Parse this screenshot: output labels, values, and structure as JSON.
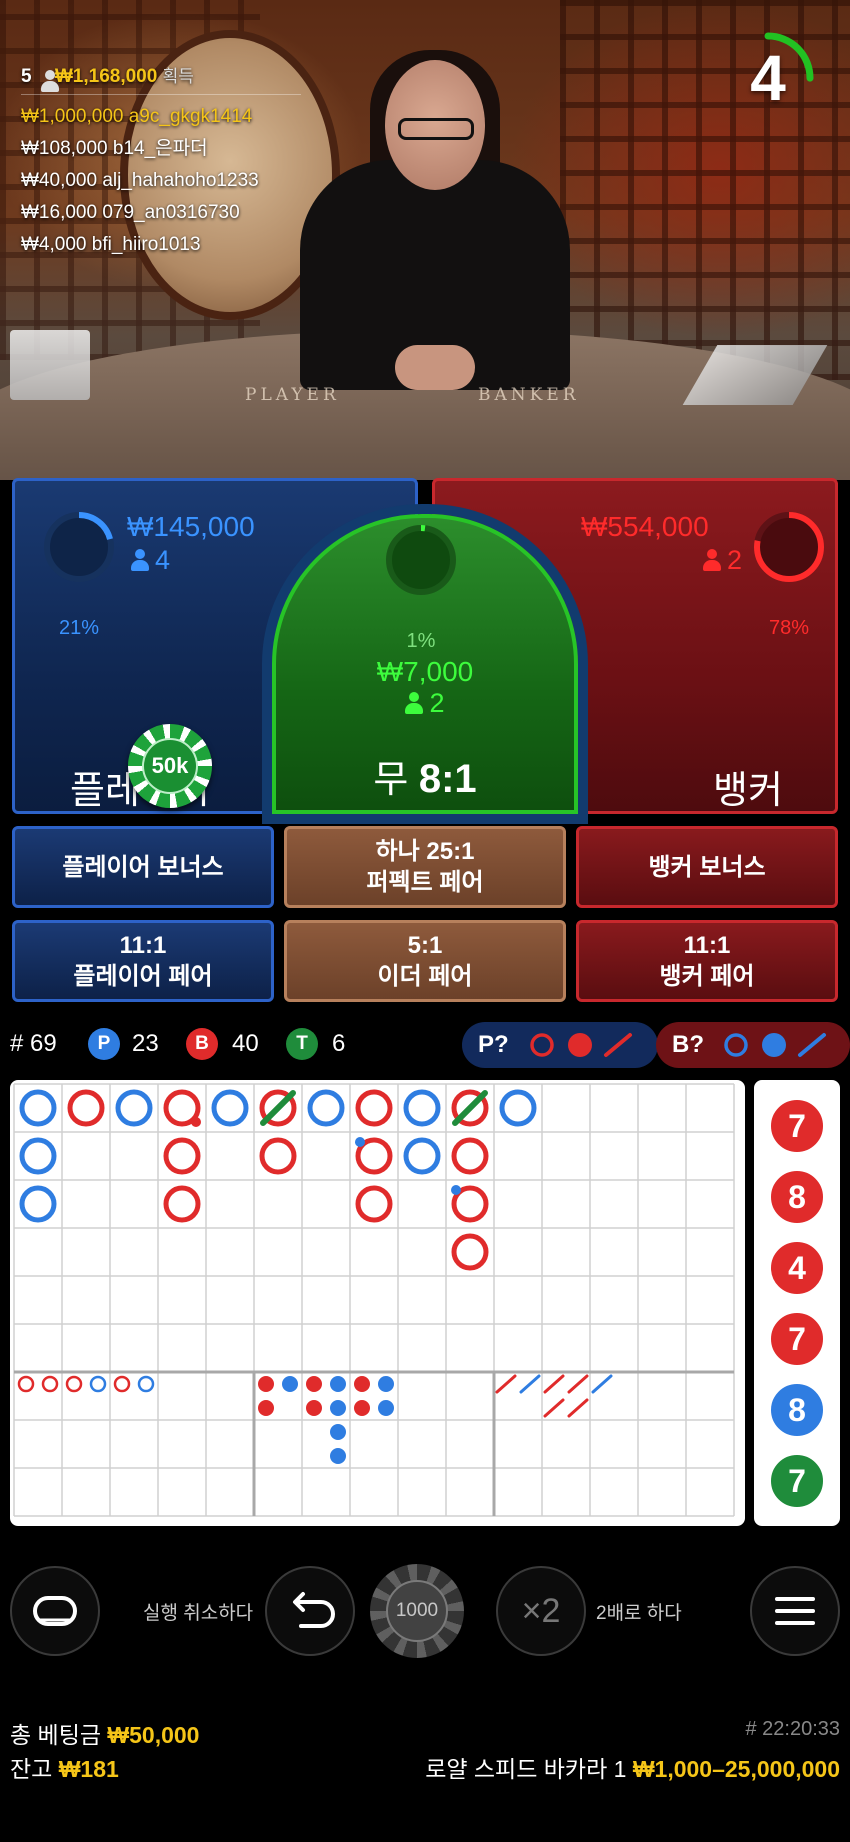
{
  "winners": {
    "count": "5",
    "total": "₩1,168,000",
    "suffix": "획득",
    "rows": [
      {
        "amount": "₩1,000,000",
        "user": "a9c_gkgk1414"
      },
      {
        "amount": "₩108,000",
        "user": "b14_은파더"
      },
      {
        "amount": "₩40,000",
        "user": "alj_hahahoho1233"
      },
      {
        "amount": "₩16,000",
        "user": "079_an0316730"
      },
      {
        "amount": "₩4,000",
        "user": "bfi_hiiro1013"
      }
    ]
  },
  "timer": {
    "value": "4",
    "fraction": 0.25
  },
  "table_felt": {
    "player": "PLAYER",
    "banker": "BANKER"
  },
  "board": {
    "player": {
      "label": "플레이어",
      "percent": "21%",
      "percent_value": 0.21,
      "amount": "₩145,000",
      "count": "4"
    },
    "tie": {
      "label": "무",
      "payout": "8:1",
      "percent": "1%",
      "percent_value": 0.01,
      "amount": "₩7,000",
      "count": "2"
    },
    "banker": {
      "label": "뱅커",
      "percent": "78%",
      "percent_value": 0.78,
      "amount": "₩554,000",
      "count": "2"
    },
    "chip": "50k"
  },
  "side_bets": {
    "player_bonus": "플레이어 보너스",
    "perfect_pair_line1": "하나 25:1",
    "perfect_pair_line2": "퍼펙트 페어",
    "banker_bonus": "뱅커 보너스",
    "player_pair_line1": "11:1",
    "player_pair_line2": "플레이어 페어",
    "either_pair_line1": "5:1",
    "either_pair_line2": "이더 페어",
    "banker_pair_line1": "11:1",
    "banker_pair_line2": "뱅커 페어"
  },
  "stats": {
    "rounds_label": "# 69",
    "player_badge": "P",
    "player_count": "23",
    "banker_badge": "B",
    "banker_count": "40",
    "tie_badge": "T",
    "tie_count": "6",
    "predict_player": "P?",
    "predict_banker": "B?"
  },
  "colors": {
    "player": "#2f7de1",
    "banker": "#e02b2b",
    "tie": "#1f8c3b",
    "gold": "#f5c518"
  },
  "big_road": [
    [
      {
        "r": 0,
        "c": 0,
        "s": "P"
      },
      {
        "r": 1,
        "c": 0,
        "s": "P"
      },
      {
        "r": 2,
        "c": 0,
        "s": "P"
      }
    ],
    [
      {
        "r": 0,
        "c": 1,
        "s": "B"
      }
    ],
    [
      {
        "r": 0,
        "c": 2,
        "s": "P"
      }
    ],
    [
      {
        "r": 0,
        "c": 3,
        "s": "B",
        "pair": "br"
      },
      {
        "r": 1,
        "c": 3,
        "s": "B"
      },
      {
        "r": 2,
        "c": 3,
        "s": "B"
      }
    ],
    [
      {
        "r": 0,
        "c": 4,
        "s": "P"
      }
    ],
    [
      {
        "r": 0,
        "c": 5,
        "s": "B",
        "tie": true
      },
      {
        "r": 1,
        "c": 5,
        "s": "B"
      }
    ],
    [
      {
        "r": 0,
        "c": 6,
        "s": "P"
      }
    ],
    [
      {
        "r": 0,
        "c": 7,
        "s": "B"
      },
      {
        "r": 1,
        "c": 7,
        "s": "B",
        "pair": "tl"
      },
      {
        "r": 2,
        "c": 7,
        "s": "B"
      }
    ],
    [
      {
        "r": 0,
        "c": 8,
        "s": "P"
      },
      {
        "r": 1,
        "c": 8,
        "s": "P"
      }
    ],
    [
      {
        "r": 0,
        "c": 9,
        "s": "B",
        "tie": true
      },
      {
        "r": 1,
        "c": 9,
        "s": "B"
      },
      {
        "r": 2,
        "c": 9,
        "s": "B",
        "pair": "tl"
      },
      {
        "r": 3,
        "c": 9,
        "s": "B"
      }
    ],
    [
      {
        "r": 0,
        "c": 10,
        "s": "P"
      }
    ]
  ],
  "big_eye_road": [
    "B",
    "B",
    "B",
    "P",
    "B",
    "P"
  ],
  "small_road": [
    {
      "r": 0,
      "c": 0,
      "s": "B"
    },
    {
      "r": 1,
      "c": 0,
      "s": "B"
    },
    {
      "r": 0,
      "c": 1,
      "s": "P"
    },
    {
      "r": 0,
      "c": 2,
      "s": "B"
    },
    {
      "r": 1,
      "c": 2,
      "s": "B"
    },
    {
      "r": 0,
      "c": 3,
      "s": "P"
    },
    {
      "r": 1,
      "c": 3,
      "s": "P"
    },
    {
      "r": 2,
      "c": 3,
      "s": "P"
    },
    {
      "r": 3,
      "c": 3,
      "s": "P"
    },
    {
      "r": 0,
      "c": 4,
      "s": "B"
    },
    {
      "r": 1,
      "c": 4,
      "s": "B"
    },
    {
      "r": 0,
      "c": 5,
      "s": "P"
    },
    {
      "r": 1,
      "c": 5,
      "s": "P"
    }
  ],
  "cockroach_road": [
    {
      "r": 0,
      "c": 0,
      "s": "B"
    },
    {
      "r": 0,
      "c": 1,
      "s": "P"
    },
    {
      "r": 0,
      "c": 2,
      "s": "B"
    },
    {
      "r": 1,
      "c": 2,
      "s": "B"
    },
    {
      "r": 0,
      "c": 3,
      "s": "B"
    },
    {
      "r": 1,
      "c": 3,
      "s": "B"
    },
    {
      "r": 0,
      "c": 4,
      "s": "P"
    }
  ],
  "bead_road": [
    {
      "value": "7",
      "s": "B"
    },
    {
      "value": "8",
      "s": "B"
    },
    {
      "value": "4",
      "s": "B"
    },
    {
      "value": "7",
      "s": "B"
    },
    {
      "value": "8",
      "s": "P"
    },
    {
      "value": "7",
      "s": "T"
    }
  ],
  "controls": {
    "undo_label": "실행 취소하다",
    "chip_value": "1000",
    "double_symbol": "×2",
    "double_label": "2배로 하다"
  },
  "footer": {
    "total_bet_label": "총 베팅금",
    "total_bet_value": "₩50,000",
    "balance_label": "잔고",
    "balance_value": "₩181",
    "round_id": "# 22:20:33",
    "table_name": "로얄 스피드 바카라 1",
    "limits": "₩1,000–25,000,000"
  }
}
